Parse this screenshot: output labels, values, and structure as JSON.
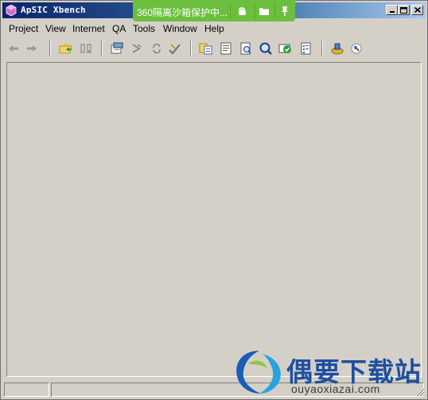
{
  "window": {
    "title": "ApSIC Xbench"
  },
  "sandbox": {
    "text": "360隔离沙箱保护中..."
  },
  "menu": [
    "Project",
    "View",
    "Internet",
    "QA",
    "Tools",
    "Window",
    "Help"
  ],
  "toolbar": [
    {
      "icon": "back-arrow-icon"
    },
    {
      "icon": "forward-arrow-icon"
    },
    {
      "icon": "open-folder-icon"
    },
    {
      "icon": "mobile-device-icon"
    },
    {
      "icon": "project-properties-icon"
    },
    {
      "icon": "refresh-icon"
    },
    {
      "icon": "sync-icon"
    },
    {
      "icon": "tools-check-icon"
    },
    {
      "icon": "copy-icon"
    },
    {
      "icon": "document-list-icon"
    },
    {
      "icon": "find-icon"
    },
    {
      "icon": "search-magnify-icon"
    },
    {
      "icon": "qa-check-icon"
    },
    {
      "icon": "checklist-icon"
    },
    {
      "icon": "settings-puzzle-icon"
    },
    {
      "icon": "help-icon"
    }
  ],
  "watermark": {
    "cn_text": "偶要下载站",
    "url": "ouyaoxiazai.com"
  },
  "colors": {
    "titlebar_start": "#0a246a",
    "sandbox_green": "#6cbf3e",
    "window_bg": "#d4d0c8"
  }
}
